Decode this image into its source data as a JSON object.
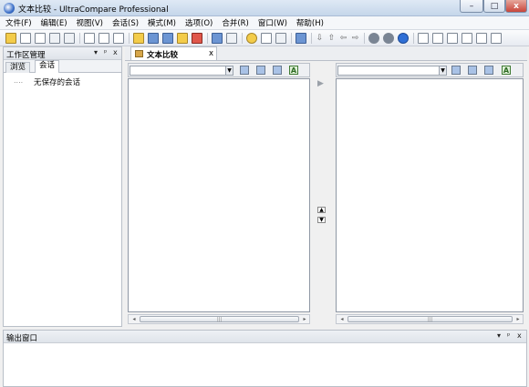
{
  "window": {
    "title": "文本比较 - UltraCompare Professional",
    "controls": {
      "minimize": "–",
      "maximize": "□",
      "close": "x"
    }
  },
  "menu": [
    "文件(F)",
    "编辑(E)",
    "视图(V)",
    "会话(S)",
    "模式(M)",
    "选项(O)",
    "合并(R)",
    "窗口(W)",
    "帮助(H)"
  ],
  "toolbar": {
    "groups": [
      [
        "new-file-icon",
        "open-file-icon",
        "copy-icon",
        "print-icon",
        "save-icon"
      ],
      [
        "asterisk-icon",
        "merge-icon",
        "list-icon"
      ],
      [
        "compare-icon",
        "folder-compare-icon",
        "sync-icon",
        "refresh-icon",
        "record-icon"
      ],
      [
        "split-vertical-icon",
        "split-horizontal-icon"
      ],
      [
        "smile-icon",
        "document-icon",
        "ignore-icon"
      ],
      [
        "grid-icon"
      ],
      [
        "down-arrow-icon",
        "up-arrow-icon",
        "left-arrow-icon",
        "right-arrow-icon"
      ],
      [
        "back-icon",
        "forward-icon",
        "info-icon"
      ],
      [
        "window-1-icon",
        "window-2-icon",
        "window-3-icon",
        "window-4-icon",
        "window-5-icon",
        "window-6-icon"
      ]
    ]
  },
  "workspace": {
    "title": "工作区管理",
    "tabs": [
      "浏览",
      "会话"
    ],
    "active_tab": "会话",
    "items": [
      "无保存的会话"
    ],
    "controls": {
      "dropdown": "▾",
      "pin": "ᵖ",
      "close": "x"
    }
  },
  "document": {
    "tab_label": "文本比较",
    "tab_close": "x",
    "scroll_grip": "|||",
    "left_arrow": "◂",
    "right_arrow": "▸",
    "play": "▶",
    "sync_up": "▲",
    "sync_down": "▼",
    "pane_icons": [
      "open-folder-icon",
      "save-pane-icon",
      "swap-icon",
      "text-a-icon"
    ],
    "text_icon_letter": "A"
  },
  "output": {
    "title": "输出窗口",
    "controls": {
      "dropdown": "▾",
      "pin": "ᵖ",
      "close": "x"
    }
  }
}
